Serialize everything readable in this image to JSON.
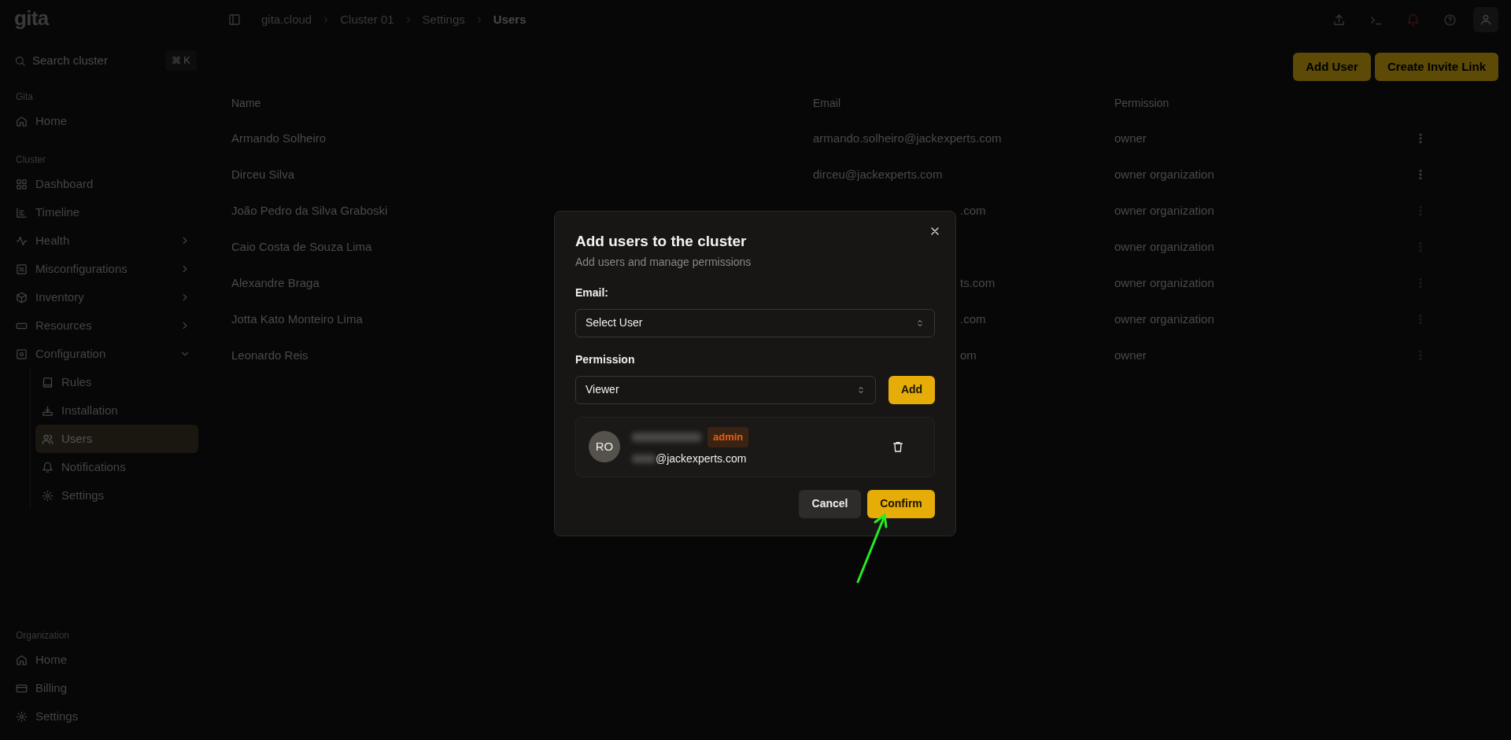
{
  "sidebar": {
    "logo": "gita",
    "search": {
      "placeholder": "Search cluster",
      "shortcut": "⌘ K"
    },
    "sections": [
      {
        "label": "Gita",
        "items": [
          {
            "label": "Home",
            "selected": false
          }
        ]
      },
      {
        "label": "Cluster",
        "items": [
          {
            "label": "Dashboard",
            "selected": false
          },
          {
            "label": "Timeline",
            "selected": false
          },
          {
            "label": "Health",
            "selected": false,
            "expanded": false
          },
          {
            "label": "Misconfigurations",
            "selected": false,
            "expanded": false
          },
          {
            "label": "Inventory",
            "selected": false,
            "expanded": false
          },
          {
            "label": "Resources",
            "selected": false,
            "expanded": false
          },
          {
            "label": "Configuration",
            "selected": false,
            "expanded": true,
            "children": [
              {
                "label": "Rules",
                "selected": false
              },
              {
                "label": "Installation",
                "selected": false
              },
              {
                "label": "Users",
                "selected": true
              },
              {
                "label": "Notifications",
                "selected": false
              },
              {
                "label": "Settings",
                "selected": false
              }
            ]
          }
        ]
      }
    ],
    "bottom_section": {
      "label": "Organization",
      "items": [
        {
          "label": "Home",
          "selected": false
        },
        {
          "label": "Billing",
          "selected": false
        },
        {
          "label": "Settings",
          "selected": false
        }
      ]
    }
  },
  "breadcrumbs": [
    "gita.cloud",
    "Cluster 01",
    "Settings",
    "Users"
  ],
  "actions": [
    "Add User",
    "Create Invite Link"
  ],
  "table": {
    "columns": [
      "Name",
      "Email",
      "Permission"
    ],
    "rows": [
      {
        "name": "Armando Solheiro",
        "email": "armando.solheiro@jackexperts.com",
        "covered": false,
        "permission": "owner"
      },
      {
        "name": "Dirceu Silva",
        "email": "dirceu@jackexperts.com",
        "covered": false,
        "permission": "owner organization"
      },
      {
        "name": "João Pedro da Silva Graboski",
        "email": ".com",
        "covered": true,
        "permission": "owner organization"
      },
      {
        "name": "Caio Costa de Souza Lima",
        "covered": true,
        "permission": "owner organization"
      },
      {
        "name": "Alexandre Braga",
        "email": "ts.com",
        "covered": true,
        "permission": "owner organization"
      },
      {
        "name": "Jotta Kato Monteiro Lima",
        "email": ".com",
        "covered": true,
        "permission": "owner organization"
      },
      {
        "name": "Leonardo Reis",
        "email": "om",
        "covered": true,
        "permission": "owner"
      }
    ]
  },
  "dialog": {
    "title": "Add users to the cluster",
    "subtitle": "Add users and manage permissions",
    "email_label": "Email:",
    "email_select": "Select User",
    "permission_label": "Permission",
    "permission_select": "Viewer",
    "add_button": "Add",
    "users": [
      {
        "initials": "RO",
        "role": "admin",
        "email_domain": "@jackexperts.com"
      }
    ],
    "buttons": [
      {
        "label": "Cancel",
        "kind": "secondary"
      },
      {
        "label": "Confirm",
        "kind": "primary"
      }
    ]
  }
}
